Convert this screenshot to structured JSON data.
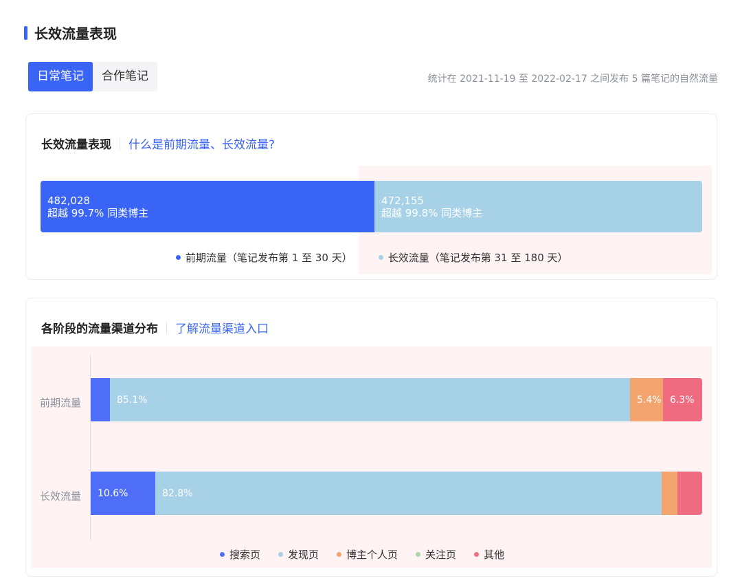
{
  "page": {
    "title": "长效流量表现"
  },
  "tabs": [
    {
      "label": "日常笔记",
      "active": true
    },
    {
      "label": "合作笔记",
      "active": false
    }
  ],
  "stat_note": "统计在 2021-11-19 至 2022-02-17 之间发布 5 篇笔记的自然流量",
  "card1": {
    "title": "长效流量表现",
    "link": "什么是前期流量、长效流量?",
    "legend": [
      {
        "label": "前期流量（笔记发布第 1 至 30 天）",
        "color": "#3a64f5"
      },
      {
        "label": "长效流量（笔记发布第 31 至 180 天）",
        "color": "#a6d1e6"
      }
    ]
  },
  "card2": {
    "title": "各阶段的流量渠道分布",
    "link": "了解流量渠道入口",
    "legend": [
      {
        "label": "搜索页",
        "color": "#4f6ef7"
      },
      {
        "label": "发现页",
        "color": "#a6d1e6"
      },
      {
        "label": "博主个人页",
        "color": "#f4a46e"
      },
      {
        "label": "关注页",
        "color": "#a8d8a8"
      },
      {
        "label": "其他",
        "color": "#ef6c80"
      }
    ]
  },
  "chart_data": [
    {
      "type": "bar",
      "orientation": "horizontal-stacked",
      "title": "长效流量表现",
      "categories": [
        "前期流量",
        "长效流量"
      ],
      "series": [
        {
          "name": "前期流量（笔记发布第 1 至 30 天）",
          "value": 482028,
          "value_label": "482,028",
          "subtitle": "超越 99.7% 同类博主",
          "color": "#3a64f5"
        },
        {
          "name": "长效流量（笔记发布第 31 至 180 天）",
          "value": 472155,
          "value_label": "472,155",
          "subtitle": "超越 99.8% 同类博主",
          "color": "#a6d1e6"
        }
      ]
    },
    {
      "type": "bar",
      "orientation": "horizontal-stacked",
      "title": "各阶段的流量渠道分布",
      "categories": [
        "前期流量",
        "长效流量"
      ],
      "series": [
        {
          "name": "搜索页",
          "color": "#4f6ef7",
          "values": [
            3.2,
            10.6
          ],
          "labels": [
            "",
            "10.6%"
          ]
        },
        {
          "name": "发现页",
          "color": "#a6d1e6",
          "values": [
            85.1,
            82.8
          ],
          "labels": [
            "85.1%",
            "82.8%"
          ]
        },
        {
          "name": "博主个人页",
          "color": "#f4a46e",
          "values": [
            5.4,
            2.6
          ],
          "labels": [
            "5.4%",
            ""
          ]
        },
        {
          "name": "关注页",
          "color": "#a8d8a8",
          "values": [
            0,
            0
          ],
          "labels": [
            "",
            ""
          ]
        },
        {
          "name": "其他",
          "color": "#ef6c80",
          "values": [
            6.3,
            4.0
          ],
          "labels": [
            "6.3%",
            ""
          ]
        }
      ]
    }
  ]
}
